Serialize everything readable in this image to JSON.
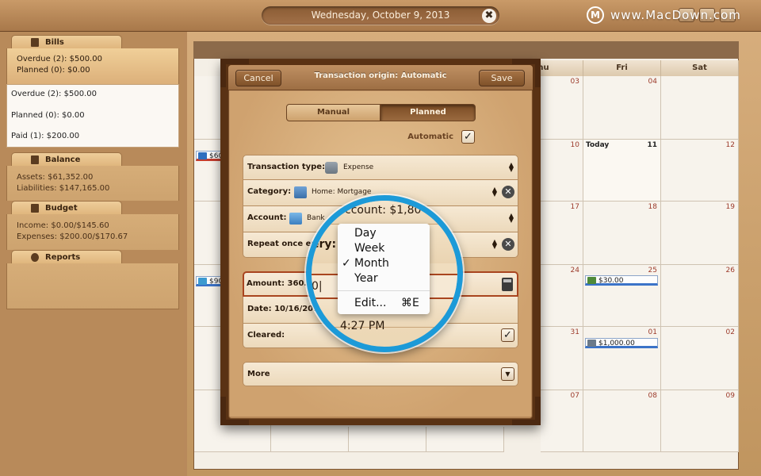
{
  "topbar": {
    "date": "Wednesday, October 9, 2013",
    "close_glyph": "✖",
    "watermark": "www.MacDown.com",
    "watermark_logo": "M"
  },
  "sidebar": {
    "bills": {
      "title": "Bills",
      "summary_overdue": "Overdue (2): $500.00",
      "summary_planned": "Planned (0): $0.00",
      "list": [
        "Overdue (2): $500.00",
        "Planned (0): $0.00",
        "Paid (1): $200.00"
      ]
    },
    "balance": {
      "title": "Balance",
      "assets": "Assets: $61,352.00",
      "liabilities": "Liabilities: $147,165.00"
    },
    "budget": {
      "title": "Budget",
      "income": "Income: $0.00/$145.60",
      "expenses": "Expenses: $200.00/$170.67"
    },
    "reports": {
      "title": "Reports"
    }
  },
  "calendar": {
    "day_headers": [
      "hu",
      "Fri",
      "Sat"
    ],
    "cells": {
      "r1": [
        "03",
        "04",
        ""
      ],
      "r2": [
        "10",
        "11",
        "12"
      ],
      "r3": [
        "17",
        "18",
        "19"
      ],
      "r4": [
        "24",
        "25",
        "26"
      ],
      "r5": [
        "31",
        "01",
        "02"
      ],
      "r6": [
        "07",
        "08",
        "09"
      ]
    },
    "today_label": "Today",
    "events": {
      "left1": "$60",
      "left2": "$90",
      "fri_25": "$30.00",
      "fri_01": "$1,000.00"
    }
  },
  "modal": {
    "cancel": "Cancel",
    "title": "Transaction origin: Automatic",
    "save": "Save",
    "seg_manual": "Manual",
    "seg_planned": "Planned",
    "automatic_label": "Automatic",
    "check_glyph": "✓",
    "rows": {
      "transaction_type_label": "Transaction type:",
      "transaction_type_value": "Expense",
      "category_label": "Category:",
      "category_value": "Home: Mortgage",
      "account_label": "Account:",
      "account_value": "Bank",
      "repeat_label": "Repeat once eve",
      "amount_label": "Amount: 360.00",
      "date_label": "Date: 10/16/2013",
      "cleared_label": "Cleared:",
      "more_label": "More"
    }
  },
  "magnifier": {
    "account_text": "ccount: $1,80",
    "every_text": "ery:",
    "amount_frag": "0|",
    "time": "4:27 PM",
    "menu": {
      "items": [
        "Day",
        "Week",
        "Month",
        "Year"
      ],
      "selected_mark": "✓",
      "edit_label": "Edit...",
      "edit_shortcut": "⌘E"
    }
  },
  "colors": {
    "magnifier_ring": "#1c9ad8",
    "amount_focus": "#a9451f",
    "event_bar": "#3b73c8"
  }
}
